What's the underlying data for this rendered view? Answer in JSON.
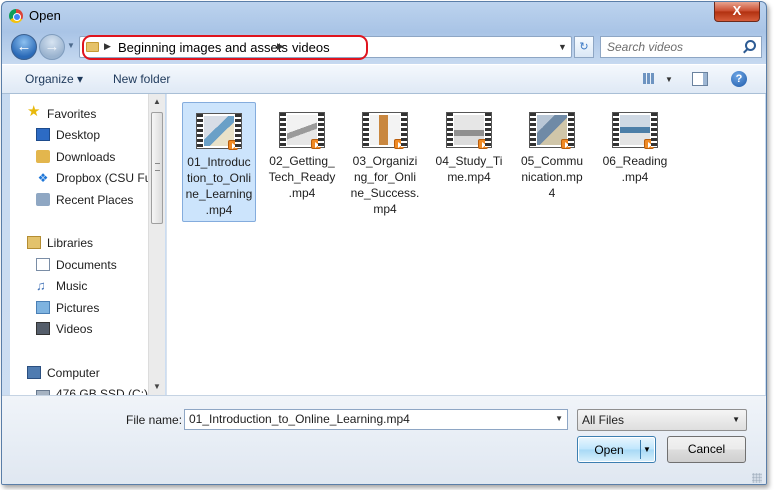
{
  "window": {
    "title": "Open",
    "close_glyph": "X"
  },
  "address": {
    "breadcrumbs": [
      "Beginning images and assets",
      "videos"
    ],
    "search_placeholder": "Search videos"
  },
  "toolbar": {
    "organize_label": "Organize ▾",
    "new_folder_label": "New folder",
    "help_glyph": "?"
  },
  "nav": {
    "items": [
      {
        "label": "Favorites",
        "icon": "star-icon",
        "indent": false
      },
      {
        "label": "Desktop",
        "icon": "desktop-icon",
        "indent": true
      },
      {
        "label": "Downloads",
        "icon": "downloads-icon",
        "indent": true
      },
      {
        "label": "Dropbox (CSU Fu",
        "icon": "dropbox-icon",
        "indent": true
      },
      {
        "label": "Recent Places",
        "icon": "recent-places-icon",
        "indent": true
      },
      {
        "label": "Libraries",
        "icon": "libraries-icon",
        "indent": false
      },
      {
        "label": "Documents",
        "icon": "documents-icon",
        "indent": true
      },
      {
        "label": "Music",
        "icon": "music-icon",
        "indent": true
      },
      {
        "label": "Pictures",
        "icon": "pictures-icon",
        "indent": true
      },
      {
        "label": "Videos",
        "icon": "videos-icon",
        "indent": true
      },
      {
        "label": "Computer",
        "icon": "computer-icon",
        "indent": false
      },
      {
        "label": "476 GB SSD (C:)",
        "icon": "drive-icon",
        "indent": true
      }
    ]
  },
  "files": [
    {
      "name": "01_Introduction_to_Online_Learning.mp4",
      "display": "01_Introduc\ntion_to_Onli\nne_Learning\n.mp4",
      "selected": true
    },
    {
      "name": "02_Getting_Tech_Ready.mp4",
      "display": "02_Getting_\nTech_Ready\n.mp4",
      "selected": false
    },
    {
      "name": "03_Organizing_for_Online_Success.mp4",
      "display": "03_Organizi\nng_for_Onli\nne_Success.\nmp4",
      "selected": false
    },
    {
      "name": "04_Study_Time.mp4",
      "display": "04_Study_Ti\nme.mp4",
      "selected": false
    },
    {
      "name": "05_Communication.mp4",
      "display": "05_Commu\nnication.mp\n4",
      "selected": false
    },
    {
      "name": "06_Reading.mp4",
      "display": "06_Reading\n.mp4",
      "selected": false
    }
  ],
  "bottom": {
    "file_name_label": "File name:",
    "file_name_value": "01_Introduction_to_Online_Learning.mp4",
    "file_type": "All Files",
    "open_label": "Open",
    "cancel_label": "Cancel"
  },
  "colors": {
    "highlight_ring": "#e0141e",
    "selection": "#cce4fc",
    "window_frame": "#a9c4e6"
  }
}
